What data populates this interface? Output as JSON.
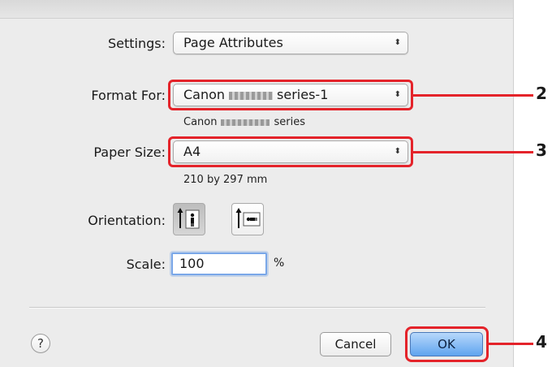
{
  "settings": {
    "label": "Settings:",
    "value": "Page Attributes"
  },
  "format_for": {
    "label": "Format For:",
    "value_prefix": "Canon",
    "value_suffix": "series-1",
    "sub_prefix": "Canon",
    "sub_suffix": "series"
  },
  "paper_size": {
    "label": "Paper Size:",
    "value": "A4",
    "dimensions": "210 by 297 mm"
  },
  "orientation": {
    "label": "Orientation:",
    "options": [
      "portrait",
      "landscape"
    ],
    "selected": "portrait"
  },
  "scale": {
    "label": "Scale:",
    "value": "100",
    "unit": "%"
  },
  "buttons": {
    "help": "?",
    "cancel": "Cancel",
    "ok": "OK"
  },
  "callouts": [
    "2",
    "3",
    "4"
  ],
  "colors": {
    "callout": "#e4232a",
    "ok_button": "#5fa4ef"
  }
}
